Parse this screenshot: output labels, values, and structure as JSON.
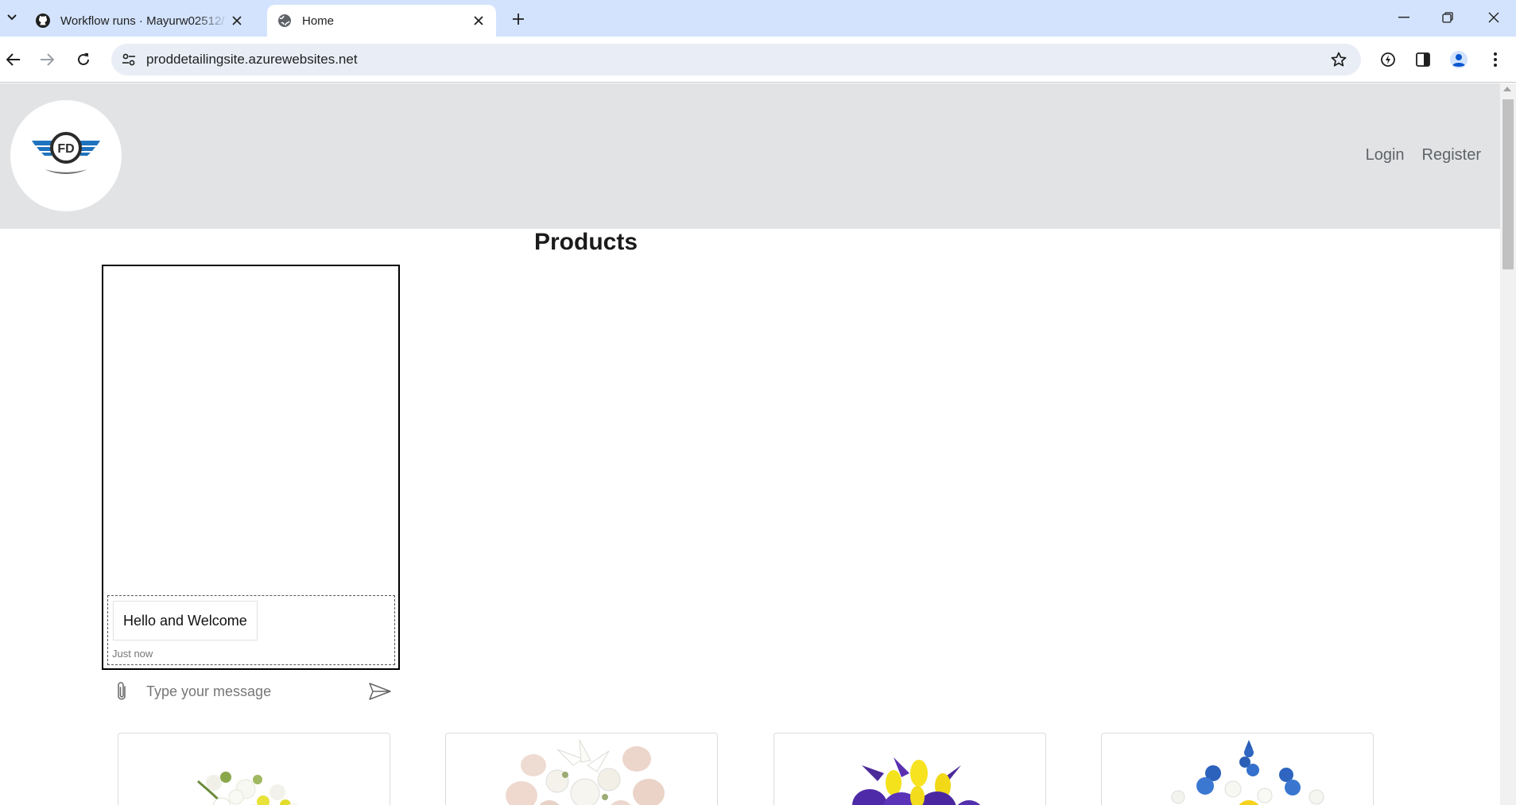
{
  "browser": {
    "tabs": [
      {
        "title": "Workflow runs · Mayurw02512/",
        "icon": "github-icon",
        "active": false
      },
      {
        "title": "Home",
        "icon": "globe-icon",
        "active": true
      }
    ],
    "url": "proddetailingsite.azurewebsites.net"
  },
  "site": {
    "logo_text": "FD",
    "nav": {
      "login": "Login",
      "register": "Register"
    }
  },
  "main": {
    "title": "Products"
  },
  "chat": {
    "messages": [
      {
        "text": "Hello and Welcome",
        "time": "Just now"
      }
    ],
    "input_placeholder": "Type your message"
  },
  "products": [
    {
      "image": "white-yellow-bouquet"
    },
    {
      "image": "pink-white-lily-bouquet"
    },
    {
      "image": "purple-yellow-iris-tulip-bouquet"
    },
    {
      "image": "blue-yellow-delphinium-bouquet"
    }
  ],
  "colors": {
    "tabstrip": "#d3e3fd",
    "header_bg": "#e2e3e5",
    "logo_blue": "#1e73be",
    "logo_dark": "#2b2b2b"
  }
}
